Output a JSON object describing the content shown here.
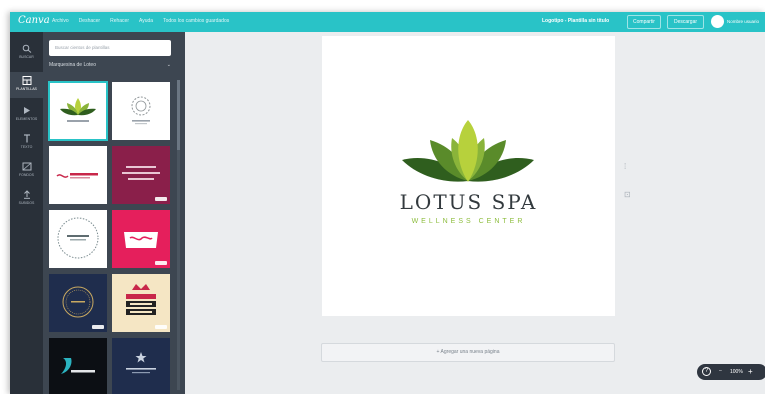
{
  "app": {
    "logo": "Canva",
    "menu": [
      "Archivo",
      "Deshacer",
      "Rehacer",
      "Ayuda",
      "Todos los cambios guardados"
    ],
    "document_title": "Logotipo - Plantilla sin título",
    "share_label": "Compartir",
    "download_label": "Descargar",
    "user_name": "Nombre usuario",
    "accent_color": "#29c3c7"
  },
  "rail": {
    "items": [
      {
        "label": "BUSCAR",
        "icon": "search-icon"
      },
      {
        "label": "PLANTILLAS",
        "icon": "layout-icon"
      },
      {
        "label": "ELEMENTOS",
        "icon": "shapes-icon"
      },
      {
        "label": "TEXTO",
        "icon": "text-icon"
      },
      {
        "label": "FONDOS",
        "icon": "background-icon"
      },
      {
        "label": "SUBIDOS",
        "icon": "upload-icon"
      }
    ]
  },
  "panel": {
    "search_placeholder": "Buscar cientos de plantillas",
    "section_title": "Marquesina de Loteo",
    "templates": [
      {
        "name": "lotus-green-leaves"
      },
      {
        "name": "circle-badge"
      },
      {
        "name": "wave-script-red"
      },
      {
        "name": "maroon-wellness"
      },
      {
        "name": "bare beauty ring"
      },
      {
        "name": "pink-seal-badge"
      },
      {
        "name": "navy-circle-badge"
      },
      {
        "name": "crown-restaurant"
      },
      {
        "name": "black-wave-brand"
      },
      {
        "name": "navy-stars-brand"
      }
    ]
  },
  "canvas": {
    "brand_name": "LOTUS SPA",
    "tagline": "WELLNESS CENTER",
    "leaf_colors": [
      "#2f5e1e",
      "#5a8b2a",
      "#8ab43a",
      "#b7d13c"
    ],
    "add_page_label": "+ Agregar una nueva página"
  },
  "zoom": {
    "value": "100%",
    "help_label": "?",
    "minus_label": "–",
    "plus_label": "+"
  }
}
